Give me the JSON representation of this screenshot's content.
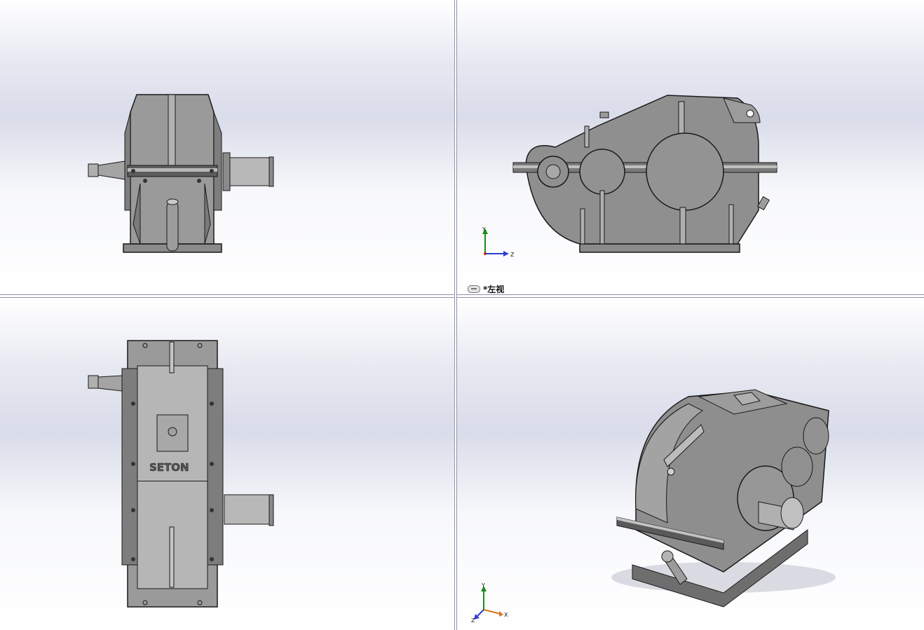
{
  "viewports": {
    "left_view": {
      "label": "*左视",
      "triad": {
        "y": "Y",
        "z": "Z"
      }
    },
    "iso_view": {
      "triad": {
        "y": "Y",
        "x": "X",
        "z": "Z"
      }
    }
  },
  "model": {
    "brand_text": "SETON"
  },
  "colors": {
    "body": "#8f8f8f",
    "body_dark": "#6d6d6d",
    "body_light": "#b0b0b0",
    "edge": "#1a1a1a",
    "axis_y": "#1c8a1c",
    "axis_x": "#c8251f",
    "axis_z": "#2b3fd0"
  }
}
